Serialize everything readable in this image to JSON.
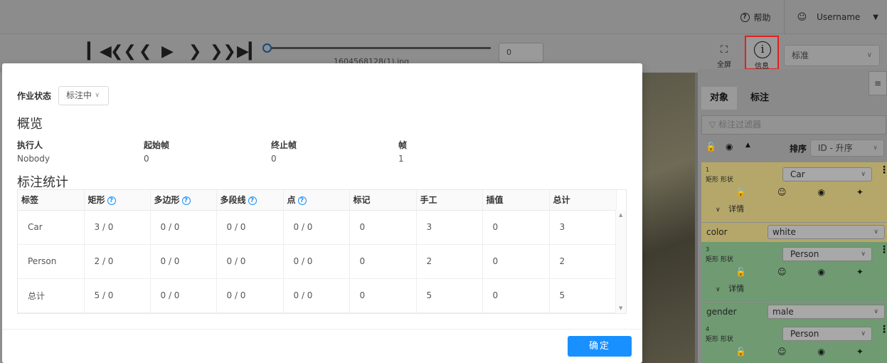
{
  "header": {
    "help_label": "帮助",
    "username": "Username"
  },
  "player": {
    "frame_filename": "1604568128(1).jpg",
    "frame_number": "0",
    "fullscreen_label": "全屏",
    "info_label": "信息",
    "workspace": "标准"
  },
  "sidebar": {
    "tab_objects": "对象",
    "tab_labels": "标注",
    "filter_placeholder": "标注过滤器",
    "sort_label": "排序",
    "sort_value": "ID - 升序",
    "objects": [
      {
        "id": "1",
        "type": "矩形 形状",
        "label": "Car",
        "details": "详情",
        "attr_name": "color",
        "attr_value": "white",
        "color": "#b5a76a"
      },
      {
        "id": "3",
        "type": "矩形 形状",
        "label": "Person",
        "details": "详情",
        "attr_name": "gender",
        "attr_value": "male",
        "color": "#6f9a72"
      },
      {
        "id": "4",
        "type": "矩形 形状",
        "label": "Person",
        "color": "#6f9a72"
      }
    ]
  },
  "modal": {
    "job_status_label": "作业状态",
    "job_status_value": "标注中",
    "overview_title": "概览",
    "overview": [
      {
        "key": "执行人",
        "value": "Nobody"
      },
      {
        "key": "起始帧",
        "value": "0"
      },
      {
        "key": "终止帧",
        "value": "0"
      },
      {
        "key": "帧",
        "value": "1"
      }
    ],
    "stats_title": "标注统计",
    "columns": [
      "标签",
      "矩形",
      "多边形",
      "多段线",
      "点",
      "标记",
      "手工",
      "插值",
      "总计"
    ],
    "rows": [
      [
        "Car",
        "3 / 0",
        "0 / 0",
        "0 / 0",
        "0 / 0",
        "0",
        "3",
        "0",
        "3"
      ],
      [
        "Person",
        "2 / 0",
        "0 / 0",
        "0 / 0",
        "0 / 0",
        "0",
        "2",
        "0",
        "2"
      ],
      [
        "总计",
        "5 / 0",
        "0 / 0",
        "0 / 0",
        "0 / 0",
        "0",
        "5",
        "0",
        "5"
      ]
    ],
    "ok_label": "确定"
  },
  "colors": {
    "accent": "#1890ff",
    "highlight_border": "#e02020"
  }
}
